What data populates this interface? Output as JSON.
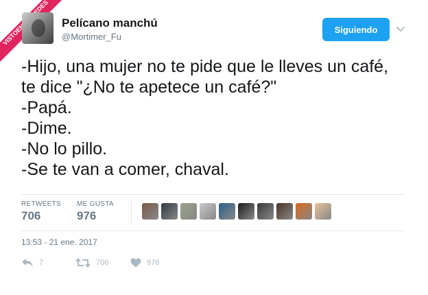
{
  "watermark": {
    "text": "VISTOENLASREDES",
    "sub": ".com"
  },
  "author": {
    "display_name": "Pelícano manchú",
    "handle": "@Mortimer_Fu"
  },
  "follow_button": {
    "label": "Siguiendo"
  },
  "tweet": {
    "lines": [
      "-Hijo, una mujer no te pide que le lleves un café,",
      "te dice \"¿No te apetece un café?\"",
      "-Papá.",
      "-Dime.",
      "-No lo pillo.",
      "-Se te van a comer, chaval."
    ]
  },
  "stats": {
    "retweets_label": "RETWEETS",
    "retweets_value": "706",
    "likes_label": "ME GUSTA",
    "likes_value": "976"
  },
  "liker_avatars": [
    {
      "color": "#7a5a48"
    },
    {
      "color": "#2f3a44"
    },
    {
      "color": "#9aa28a"
    },
    {
      "color": "#c8c8c8"
    },
    {
      "color": "#2c5f8a"
    },
    {
      "color": "#1e1e1e"
    },
    {
      "color": "#3a3a3a"
    },
    {
      "color": "#4a3526"
    },
    {
      "color": "#d9691e"
    },
    {
      "color": "#e8c29a"
    }
  ],
  "timestamp": "13:53 - 21 ene. 2017",
  "actions": {
    "reply_count": "7",
    "retweet_count": "706",
    "like_count": "976"
  },
  "colors": {
    "accent": "#1da1f2",
    "text": "#14171a",
    "muted": "#657786",
    "icon": "#aab8c2",
    "watermark": "#e0245e"
  },
  "icons": {
    "reply": "reply-icon",
    "retweet": "retweet-icon",
    "like": "heart-icon",
    "caret": "chevron-down-icon"
  }
}
